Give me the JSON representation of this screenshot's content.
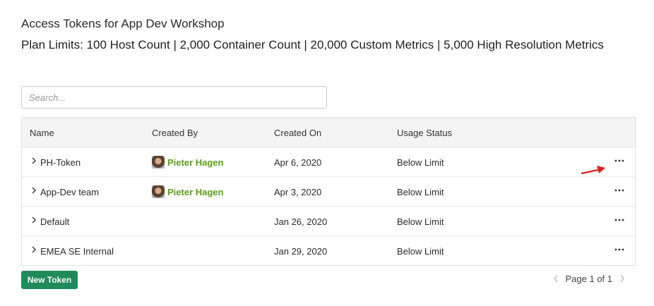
{
  "page": {
    "title": "Access Tokens for App Dev Workshop",
    "plan_limits": "Plan Limits: 100 Host Count | 2,000 Container Count | 20,000 Custom Metrics | 5,000 High Resolution Metrics"
  },
  "search": {
    "placeholder": "Search..."
  },
  "table": {
    "headers": {
      "name": "Name",
      "created_by": "Created By",
      "created_on": "Created On",
      "usage_status": "Usage Status"
    },
    "rows": [
      {
        "name": "PH-Token",
        "created_by": "Pieter Hagen",
        "created_on": "Apr 6, 2020",
        "usage_status": "Below Limit"
      },
      {
        "name": "App-Dev team",
        "created_by": "Pieter Hagen",
        "created_on": "Apr 3, 2020",
        "usage_status": "Below Limit"
      },
      {
        "name": "Default",
        "created_by": "",
        "created_on": "Jan 26, 2020",
        "usage_status": "Below Limit"
      },
      {
        "name": "EMEA SE Internal",
        "created_by": "",
        "created_on": "Jan 29, 2020",
        "usage_status": "Below Limit"
      }
    ]
  },
  "footer": {
    "new_token_label": "New Token",
    "page_label": "Page 1 of 1"
  },
  "colors": {
    "accent_green": "#1f8a5a",
    "user_link": "#5c9e1a",
    "annotation_arrow": "#e0201c"
  },
  "icons": {
    "expand": "chevron-right-icon",
    "actions": "more-horizontal-icon",
    "prev": "chevron-left-icon",
    "next": "chevron-right-icon"
  }
}
